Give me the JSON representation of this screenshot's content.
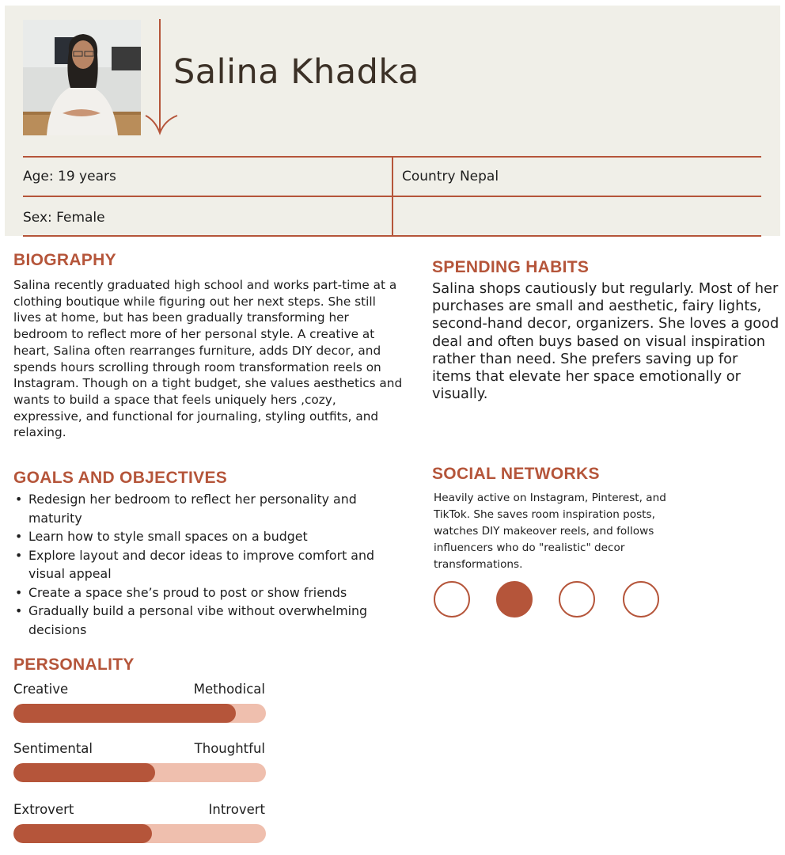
{
  "profile": {
    "name": "Salina Khadka",
    "age": "Age: 19 years",
    "country": "Country Nepal",
    "sex": "Sex: Female"
  },
  "biography": {
    "title": "BIOGRAPHY",
    "text": "Salina recently graduated high school and works part-time at a clothing boutique while figuring out her next steps. She still lives at home, but has been gradually transforming her bedroom to reflect more of her personal style. A creative at heart, Salina often rearranges furniture, adds DIY decor, and spends hours scrolling through room transformation reels on Instagram. Though on a tight budget, she values aesthetics and wants to build a space that feels uniquely hers ,cozy, expressive, and functional for journaling, styling outfits, and relaxing."
  },
  "goals": {
    "title": "GOALS AND OBJECTIVES",
    "items": [
      "Redesign her bedroom to reflect her personality and maturity",
      "Learn how to style small spaces on a budget",
      "Explore layout and decor ideas to improve comfort and visual appeal",
      "Create a space she’s proud to post or show friends",
      "Gradually build a personal vibe without overwhelming decisions"
    ]
  },
  "personality": {
    "title": "PERSONALITY",
    "traits": [
      {
        "left": "Creative",
        "right": "Methodical",
        "level": 0.88
      },
      {
        "left": "Sentimental",
        "right": "Thoughtful",
        "level": 0.56
      },
      {
        "left": "Extrovert",
        "right": "Introvert",
        "level": 0.55
      }
    ]
  },
  "spending": {
    "title": "SPENDING HABITS",
    "text": "Salina shops cautiously but regularly. Most of her purchases are small and aesthetic, fairy lights, second-hand decor, organizers. She loves a good deal and often buys based on visual inspiration rather than need. She prefers saving up for items that elevate her space emotionally or visually."
  },
  "social": {
    "title": "SOCIAL NETWORKS",
    "text": "Heavily active on Instagram, Pinterest, and TikTok. She saves room inspiration posts, watches DIY makeover reels, and follows influencers who do \"realistic\" decor transformations.",
    "indicators": [
      false,
      true,
      false,
      false
    ]
  },
  "colors": {
    "accent": "#b5553a",
    "accent_light": "#efbfae",
    "header_bg": "#f0efe8"
  }
}
